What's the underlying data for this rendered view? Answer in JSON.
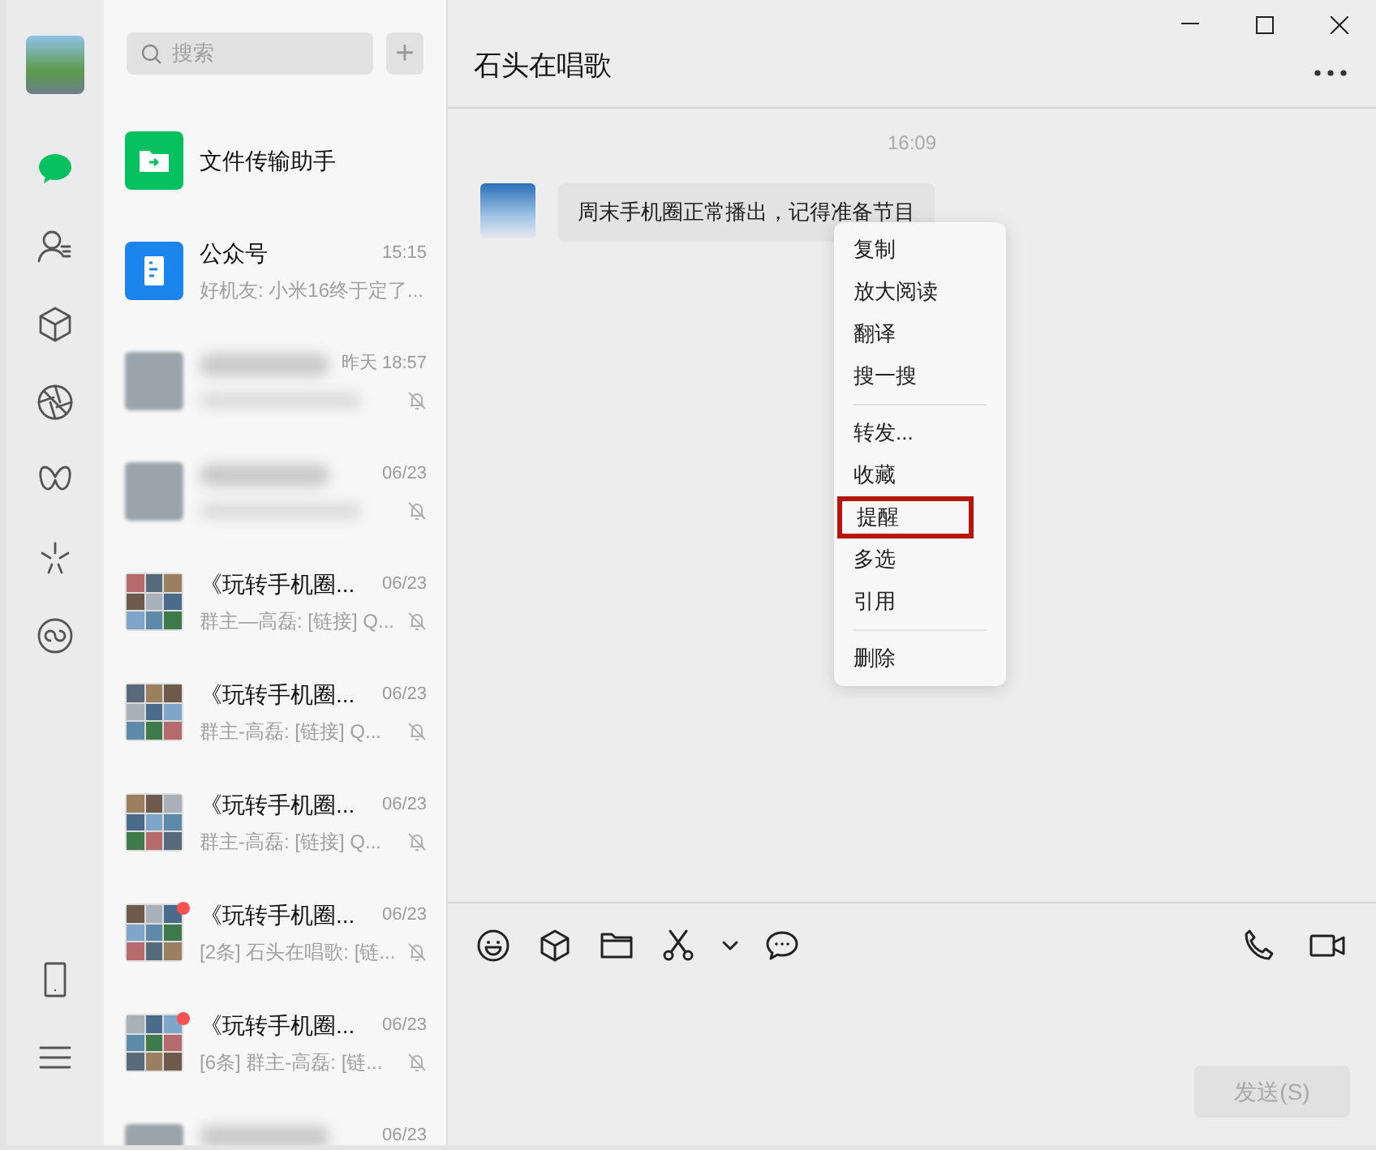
{
  "nav": {
    "items": [
      {
        "kind": "chat",
        "selected": true
      },
      {
        "kind": "contacts",
        "selected": false
      },
      {
        "kind": "box",
        "selected": false
      },
      {
        "kind": "aperture",
        "selected": false
      },
      {
        "kind": "loop",
        "selected": false
      },
      {
        "kind": "spark",
        "selected": false
      },
      {
        "kind": "link",
        "selected": false
      }
    ],
    "bottom": [
      {
        "kind": "phone"
      },
      {
        "kind": "menu"
      }
    ]
  },
  "search": {
    "placeholder": "搜索"
  },
  "add_button": "+",
  "chats": [
    {
      "kind": "file",
      "name": "文件传输助手",
      "muted": false,
      "unread": false,
      "blurred": false
    },
    {
      "kind": "official",
      "name": "公众号",
      "time": "15:15",
      "preview": "好机友: 小米16终于定了...",
      "muted": false,
      "unread": false,
      "blurred": false
    },
    {
      "kind": "photo",
      "time": "昨天 18:57",
      "muted": true,
      "unread": false,
      "blurred": true
    },
    {
      "kind": "photo",
      "time": "06/23",
      "muted": true,
      "unread": false,
      "blurred": true
    },
    {
      "kind": "group",
      "name": "《玩转手机圈...",
      "time": "06/23",
      "preview": "群主—高磊: [链接] Q...",
      "muted": true,
      "unread": false,
      "blurred": false
    },
    {
      "kind": "group",
      "name": "《玩转手机圈...",
      "time": "06/23",
      "preview": "群主-高磊: [链接] Q...",
      "muted": true,
      "unread": false,
      "blurred": false
    },
    {
      "kind": "group",
      "name": "《玩转手机圈...",
      "time": "06/23",
      "preview": "群主-高磊: [链接] Q...",
      "muted": true,
      "unread": false,
      "blurred": false
    },
    {
      "kind": "group",
      "name": "《玩转手机圈...",
      "time": "06/23",
      "preview": "[2条] 石头在唱歌: [链...",
      "muted": true,
      "unread": true,
      "blurred": false
    },
    {
      "kind": "group",
      "name": "《玩转手机圈...",
      "time": "06/23",
      "preview": "[6条] 群主-高磊: [链...",
      "muted": true,
      "unread": true,
      "blurred": false
    },
    {
      "kind": "photo",
      "time": "06/23",
      "muted": false,
      "unread": false,
      "blurred": true
    }
  ],
  "chat": {
    "title": "石头在唱歌",
    "messages": [
      {
        "kind": "time",
        "text": "16:09"
      },
      {
        "kind": "incoming",
        "text": "周末手机圈正常播出，记得准备节目"
      }
    ]
  },
  "context_menu": {
    "groups": [
      [
        {
          "label": "复制",
          "highlighted": false
        },
        {
          "label": "放大阅读",
          "highlighted": false
        },
        {
          "label": "翻译",
          "highlighted": false
        },
        {
          "label": "搜一搜",
          "highlighted": false
        }
      ],
      [
        {
          "label": "转发...",
          "highlighted": false
        },
        {
          "label": "收藏",
          "highlighted": false
        },
        {
          "label": "提醒",
          "highlighted": true
        },
        {
          "label": "多选",
          "highlighted": false
        },
        {
          "label": "引用",
          "highlighted": false
        }
      ],
      [
        {
          "label": "删除",
          "highlighted": false
        }
      ]
    ]
  },
  "toolbar": {
    "left": [
      {
        "kind": "emoji"
      },
      {
        "kind": "box"
      },
      {
        "kind": "folder"
      },
      {
        "kind": "scissors"
      },
      {
        "kind": "caret"
      },
      {
        "kind": "bubble"
      }
    ],
    "right": [
      {
        "kind": "phone"
      },
      {
        "kind": "video"
      }
    ]
  },
  "send_button": {
    "label": "发送(S)",
    "disabled": true
  }
}
